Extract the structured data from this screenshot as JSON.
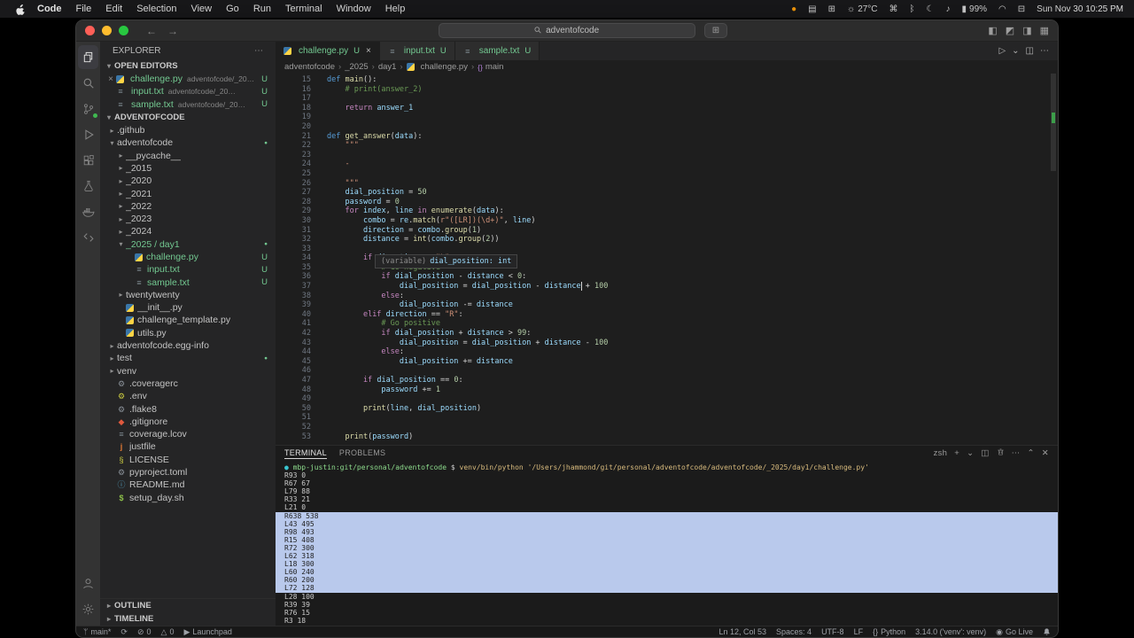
{
  "menubar": {
    "menus": [
      "Code",
      "File",
      "Edit",
      "Selection",
      "View",
      "Go",
      "Run",
      "Terminal",
      "Window",
      "Help"
    ],
    "status_items": [
      {
        "name": "screen-record-indicator",
        "glyph": "●",
        "color": "#ff9f0a"
      },
      {
        "name": "performance-icon",
        "glyph": "▤"
      },
      {
        "name": "screen-mirroring-icon",
        "glyph": "⊞"
      },
      {
        "name": "weather-item",
        "glyph": "☼",
        "text": "27°C"
      },
      {
        "name": "shortcuts-icon",
        "glyph": "⌘"
      },
      {
        "name": "bluetooth-icon",
        "glyph": "ᛒ"
      },
      {
        "name": "focus-mode-icon",
        "glyph": "☾"
      },
      {
        "name": "sound-icon",
        "glyph": "♪"
      },
      {
        "name": "battery-item",
        "glyph": "▮",
        "text": "99%"
      },
      {
        "name": "wifi-icon",
        "glyph": "◠"
      },
      {
        "name": "control-center-icon",
        "glyph": "⊟"
      },
      {
        "name": "clock-item",
        "text": "Sun Nov 30 10:25 PM"
      }
    ]
  },
  "titlebar": {
    "search": "adventofcode",
    "nav": [
      {
        "name": "nav-back-button",
        "glyph": "←"
      },
      {
        "name": "nav-forward-button",
        "glyph": "→"
      }
    ],
    "extra_glyph": "⊞",
    "actions": [
      {
        "name": "toggle-primary-sidebar-button",
        "glyph": "◧"
      },
      {
        "name": "toggle-panel-button",
        "glyph": "◩"
      },
      {
        "name": "toggle-secondary-sidebar-button",
        "glyph": "◨"
      },
      {
        "name": "customize-layout-button",
        "glyph": "▦"
      }
    ]
  },
  "activity_bar": {
    "top": [
      {
        "name": "explorer",
        "icon": "files",
        "active": true
      },
      {
        "name": "search",
        "icon": "search"
      },
      {
        "name": "source-control",
        "icon": "scm",
        "badge": true
      },
      {
        "name": "run-and-debug",
        "icon": "debug"
      },
      {
        "name": "extensions",
        "icon": "extensions"
      },
      {
        "name": "testing",
        "icon": "testing"
      },
      {
        "name": "docker",
        "icon": "docker"
      },
      {
        "name": "remote-explorer",
        "icon": "remote"
      }
    ],
    "bottom": [
      {
        "name": "accounts",
        "icon": "account"
      },
      {
        "name": "settings",
        "icon": "settings"
      }
    ]
  },
  "sidebar": {
    "title": "EXPLORER",
    "sections": {
      "open_editors": "OPEN EDITORS",
      "root": "ADVENTOFCODE",
      "outline": "OUTLINE",
      "timeline": "TIMELINE"
    },
    "open_editors": [
      {
        "close": "×",
        "icon": "python",
        "label": "challenge.py",
        "desc": "adventofcode/_202...",
        "badge": "U",
        "green": true
      },
      {
        "close": "",
        "icon": "text",
        "label": "input.txt",
        "desc": "adventofcode/_2025/day1",
        "badge": "U",
        "green": true
      },
      {
        "close": "",
        "icon": "text",
        "label": "sample.txt",
        "desc": "adventofcode/_2025/...",
        "badge": "U",
        "green": true
      }
    ],
    "tree": [
      {
        "label": ".github",
        "level": 0,
        "type": "folder"
      },
      {
        "label": "adventofcode",
        "level": 0,
        "type": "folder",
        "expanded": true,
        "badge": "dot"
      },
      {
        "label": "__pycache__",
        "level": 1,
        "type": "folder"
      },
      {
        "label": "_2015",
        "level": 1,
        "type": "folder"
      },
      {
        "label": "_2020",
        "level": 1,
        "type": "folder"
      },
      {
        "label": "_2021",
        "level": 1,
        "type": "folder"
      },
      {
        "label": "_2022",
        "level": 1,
        "type": "folder"
      },
      {
        "label": "_2023",
        "level": 1,
        "type": "folder"
      },
      {
        "label": "_2024",
        "level": 1,
        "type": "folder"
      },
      {
        "label": "_2025 / day1",
        "level": 1,
        "type": "folder",
        "expanded": true,
        "badge": "dot",
        "green": true
      },
      {
        "label": "challenge.py",
        "level": 2,
        "type": "file",
        "icon": "python",
        "badge": "U",
        "green": true
      },
      {
        "label": "input.txt",
        "level": 2,
        "type": "file",
        "icon": "text",
        "badge": "U",
        "green": true
      },
      {
        "label": "sample.txt",
        "level": 2,
        "type": "file",
        "icon": "text",
        "badge": "U",
        "green": true
      },
      {
        "label": "twentytwenty",
        "level": 1,
        "type": "folder"
      },
      {
        "label": "__init__.py",
        "level": 1,
        "type": "file",
        "icon": "python"
      },
      {
        "label": "challenge_template.py",
        "level": 1,
        "type": "file",
        "icon": "python"
      },
      {
        "label": "utils.py",
        "level": 1,
        "type": "file",
        "icon": "python"
      },
      {
        "label": "adventofcode.egg-info",
        "level": 0,
        "type": "folder"
      },
      {
        "label": "test",
        "level": 0,
        "type": "folder",
        "badge": "dot"
      },
      {
        "label": "venv",
        "level": 0,
        "type": "folder"
      },
      {
        "label": ".coveragerc",
        "level": 0,
        "type": "file",
        "icon": "gear"
      },
      {
        "label": ".env",
        "level": 0,
        "type": "file",
        "icon": "gear-yellow"
      },
      {
        "label": ".flake8",
        "level": 0,
        "type": "file",
        "icon": "gear"
      },
      {
        "label": ".gitignore",
        "level": 0,
        "type": "file",
        "icon": "git"
      },
      {
        "label": "coverage.lcov",
        "level": 0,
        "type": "file",
        "icon": "text"
      },
      {
        "label": "justfile",
        "level": 0,
        "type": "file",
        "icon": "just"
      },
      {
        "label": "LICENSE",
        "level": 0,
        "type": "file",
        "icon": "license"
      },
      {
        "label": "pyproject.toml",
        "level": 0,
        "type": "file",
        "icon": "gear"
      },
      {
        "label": "README.md",
        "level": 0,
        "type": "file",
        "icon": "info"
      },
      {
        "label": "setup_day.sh",
        "level": 0,
        "type": "file",
        "icon": "shell"
      }
    ]
  },
  "editor": {
    "tabs": [
      {
        "label": "challenge.py",
        "icon": "python",
        "badge": "U",
        "active": true
      },
      {
        "label": "input.txt",
        "icon": "text",
        "badge": "U"
      },
      {
        "label": "sample.txt",
        "icon": "text",
        "badge": "U"
      }
    ],
    "actions": [
      {
        "name": "run-file-button",
        "glyph": "▷"
      },
      {
        "name": "run-dropdown",
        "glyph": "⌄"
      },
      {
        "name": "split-editor-button",
        "glyph": "◫"
      },
      {
        "name": "editor-more-button",
        "glyph": "⋯"
      }
    ],
    "breadcrumb": [
      {
        "label": "adventofcode"
      },
      {
        "label": "_2025"
      },
      {
        "label": "day1"
      },
      {
        "label": "challenge.py",
        "icon": "python"
      },
      {
        "label": "main",
        "icon": "{}"
      }
    ],
    "tooltip": {
      "prefix": "(variable)",
      "text": "dial_position: int"
    },
    "cursor_status": "Ln 12, Col 53",
    "lines": [
      {
        "n": 15,
        "t": "def main():"
      },
      {
        "n": 16,
        "t": "    # print(answer_2)"
      },
      {
        "n": 17,
        "t": ""
      },
      {
        "n": 18,
        "t": "    return answer_1"
      },
      {
        "n": 19,
        "t": ""
      },
      {
        "n": 20,
        "t": ""
      },
      {
        "n": 21,
        "t": "def get_answer(data):"
      },
      {
        "n": 22,
        "t": "    \"\"\""
      },
      {
        "n": 23,
        "t": ""
      },
      {
        "n": 24,
        "t": "    -"
      },
      {
        "n": 25,
        "t": ""
      },
      {
        "n": 26,
        "t": "    \"\"\""
      },
      {
        "n": 27,
        "t": "    dial_position = 50"
      },
      {
        "n": 28,
        "t": "    password = 0"
      },
      {
        "n": 29,
        "t": "    for index, line in enumerate(data):"
      },
      {
        "n": 30,
        "t": "        combo = re.match(r\"([LR])(\\d+)\", line)"
      },
      {
        "n": 31,
        "t": "        direction = combo.group(1)"
      },
      {
        "n": 32,
        "t": "        distance = int(combo.group(2))"
      },
      {
        "n": 33,
        "t": ""
      },
      {
        "n": 34,
        "t": "        if direction == \"L\":"
      },
      {
        "n": 35,
        "t": "            # Go negative"
      },
      {
        "n": 36,
        "t": "            if dial_position - distance < 0:"
      },
      {
        "n": 37,
        "t": "                dial_position = dial_position - distance + 100"
      },
      {
        "n": 38,
        "t": "            else:"
      },
      {
        "n": 39,
        "t": "                dial_position -= distance"
      },
      {
        "n": 40,
        "t": "        elif direction == \"R\":"
      },
      {
        "n": 41,
        "t": "            # Go positive"
      },
      {
        "n": 42,
        "t": "            if dial_position + distance > 99:"
      },
      {
        "n": 43,
        "t": "                dial_position = dial_position + distance - 100"
      },
      {
        "n": 44,
        "t": "            else:"
      },
      {
        "n": 45,
        "t": "                dial_position += distance"
      },
      {
        "n": 46,
        "t": ""
      },
      {
        "n": 47,
        "t": "        if dial_position == 0:"
      },
      {
        "n": 48,
        "t": "            password += 1"
      },
      {
        "n": 49,
        "t": ""
      },
      {
        "n": 50,
        "t": "        print(line, dial_position)"
      },
      {
        "n": 51,
        "t": ""
      },
      {
        "n": 52,
        "t": ""
      },
      {
        "n": 53,
        "t": "    print(password)"
      }
    ]
  },
  "terminal": {
    "tabs": [
      {
        "label": "TERMINAL",
        "active": true
      },
      {
        "label": "PROBLEMS"
      }
    ],
    "actions": [
      {
        "name": "terminal-shell-label",
        "label": "zsh"
      },
      {
        "name": "new-terminal-button",
        "glyph": "+"
      },
      {
        "name": "terminal-profile-dropdown",
        "glyph": "⌄"
      },
      {
        "name": "split-terminal-button",
        "glyph": "◫"
      },
      {
        "name": "kill-terminal-button",
        "svg": "trash"
      },
      {
        "name": "terminal-more-button",
        "glyph": "⋯"
      },
      {
        "name": "maximize-panel-button",
        "glyph": "⌃"
      },
      {
        "name": "close-panel-button",
        "glyph": "✕"
      }
    ],
    "prompt_dot": "●",
    "prompt": "mbp-justin:git/personal/adventofcode",
    "dollar": " $ ",
    "command": "venv/bin/python '/Users/jhammond/git/personal/adventofcode/adventofcode/_2025/day1/challenge.py'",
    "output": [
      "R93 0",
      "R67 67",
      "L79 88",
      "R33 21",
      "L21 0",
      "R638 538",
      "L43 495",
      "R98 493",
      "R15 408",
      "R72 300",
      "L62 318",
      "L18 300",
      "L60 240",
      "R60 200",
      "L72 128",
      "L28 100",
      "R39 39",
      "R76 15",
      "R3 18"
    ],
    "selection": {
      "start": 5,
      "end": 14
    }
  },
  "statusbar": {
    "left": [
      {
        "name": "git-branch-item",
        "glyph": "ᛘ",
        "label": "main*"
      },
      {
        "name": "sync-changes-item",
        "glyph": "⟳"
      },
      {
        "name": "errors-item",
        "glyph": "⊘",
        "label": "0"
      },
      {
        "name": "warnings-item",
        "glyph": "△",
        "label": "0"
      },
      {
        "name": "launchpad-item",
        "glyph": "▶",
        "label": "Launchpad"
      }
    ],
    "right": [
      {
        "name": "cursor-position-item",
        "label": "Ln 12, Col 53"
      },
      {
        "name": "indentation-item",
        "label": "Spaces: 4"
      },
      {
        "name": "encoding-item",
        "label": "UTF-8"
      },
      {
        "name": "eol-item",
        "label": "LF"
      },
      {
        "name": "language-mode-item",
        "glyph": "{}",
        "label": "Python"
      },
      {
        "name": "python-interpreter-item",
        "label": "3.14.0 ('venv': venv)"
      },
      {
        "name": "go-live-item",
        "glyph": "◉",
        "label": "Go Live"
      },
      {
        "name": "notifications-bell",
        "svg": "bell"
      }
    ]
  },
  "colors": {
    "accent": "#007acc",
    "git_untracked": "#73c991",
    "terminal_selection": "#b9c9ec"
  }
}
